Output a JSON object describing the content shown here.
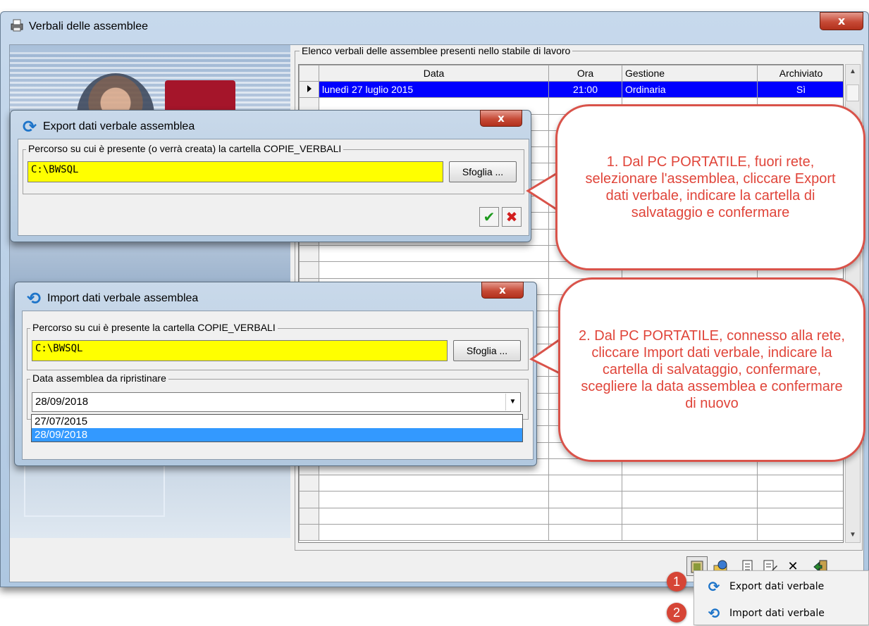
{
  "main_window": {
    "title": "Verbali delle assemblee",
    "group_legend": "Elenco verbali delle assemblee presenti nello stabile di lavoro",
    "columns": [
      "Data",
      "Ora",
      "Gestione",
      "Archiviato"
    ],
    "rows": [
      {
        "data": "lunedì 27 luglio 2015",
        "ora": "21:00",
        "gestione": "Ordinaria",
        "archiviato": "Sì"
      }
    ],
    "close_label": "x",
    "toolbar_icons": [
      "export-import-icon",
      "globe-folder-icon",
      "new-document-icon",
      "edit-icon",
      "delete-icon",
      "exit-door-icon"
    ]
  },
  "export_dialog": {
    "title": "Export dati verbale assemblea",
    "close_label": "x",
    "fieldset_legend": "Percorso su cui è presente (o verrà creata) la cartella COPIE_VERBALI",
    "path_value": "C:\\BWSQL",
    "browse_label": "Sfoglia ...",
    "ok_label": "✔",
    "cancel_label": "✖"
  },
  "import_dialog": {
    "title": "Import dati verbale assemblea",
    "close_label": "x",
    "path_legend": "Percorso su cui è presente la cartella COPIE_VERBALI",
    "path_value": "C:\\BWSQL",
    "browse_label": "Sfoglia ...",
    "date_legend": "Data assemblea da ripristinare",
    "selected_date": "28/09/2018",
    "date_options": [
      "27/07/2015",
      "28/09/2018"
    ],
    "selected_option_index": 1
  },
  "callouts": {
    "export": "1. Dal PC PORTATILE, fuori rete, selezionare l'assemblea, cliccare Export dati verbale, indicare la cartella di salvataggio e confermare",
    "import": "2. Dal PC PORTATILE, connesso alla rete, cliccare Import dati verbale, indicare la cartella di salvataggio, confermare, scegliere la data assemblea e confermare di nuovo"
  },
  "context_menu": {
    "items": [
      {
        "badge": "1",
        "label": "Export dati verbale",
        "accelerator": "E"
      },
      {
        "badge": "2",
        "label": "Import dati verbale",
        "accelerator": "I"
      }
    ]
  },
  "colors": {
    "highlight_field": "#ffff00",
    "selected_row": "#0000ff",
    "callout_border": "#d9534a",
    "callout_text": "#e0453a",
    "badge": "#d64536"
  }
}
